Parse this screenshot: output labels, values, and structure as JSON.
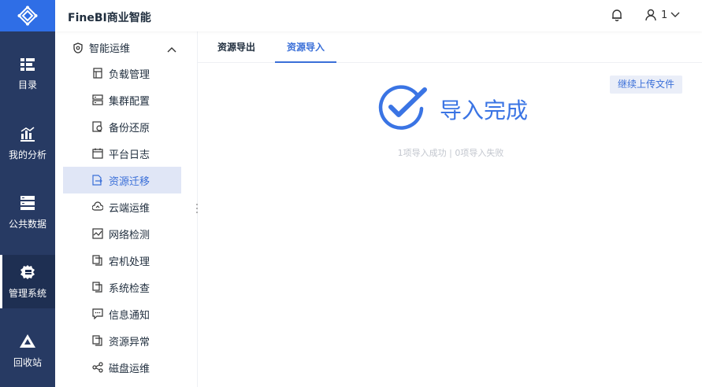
{
  "app": {
    "title": "FineBI商业智能"
  },
  "leftnav": {
    "items": [
      {
        "label": "目录",
        "icon": "catalog-icon"
      },
      {
        "label": "我的分析",
        "icon": "analysis-icon"
      },
      {
        "label": "公共数据",
        "icon": "database-icon"
      },
      {
        "label": "管理系统",
        "icon": "manage-gear-icon",
        "active": true
      },
      {
        "label": "回收站",
        "icon": "recycle-icon"
      }
    ]
  },
  "header": {
    "user_name": "1"
  },
  "sidebar": {
    "group_title": "智能运维",
    "items": [
      {
        "label": "负载管理"
      },
      {
        "label": "集群配置"
      },
      {
        "label": "备份还原"
      },
      {
        "label": "平台日志"
      },
      {
        "label": "资源迁移",
        "active": true
      },
      {
        "label": "云端运维"
      },
      {
        "label": "网络检测"
      },
      {
        "label": "宕机处理"
      },
      {
        "label": "系统检查"
      },
      {
        "label": "信息通知"
      },
      {
        "label": "资源异常"
      },
      {
        "label": "磁盘运维"
      }
    ]
  },
  "tabs": [
    {
      "label": "资源导出"
    },
    {
      "label": "资源导入",
      "active": true
    }
  ],
  "main": {
    "continue_button": "继续上传文件",
    "status_title": "导入完成",
    "summary": "1项导入成功 | 0项导入失败"
  },
  "colors": {
    "nav_bg": "#273a63",
    "logo_bg": "#2f6ee6",
    "accent": "#3a6fd8",
    "active_item_bg": "#e0e6f6"
  }
}
